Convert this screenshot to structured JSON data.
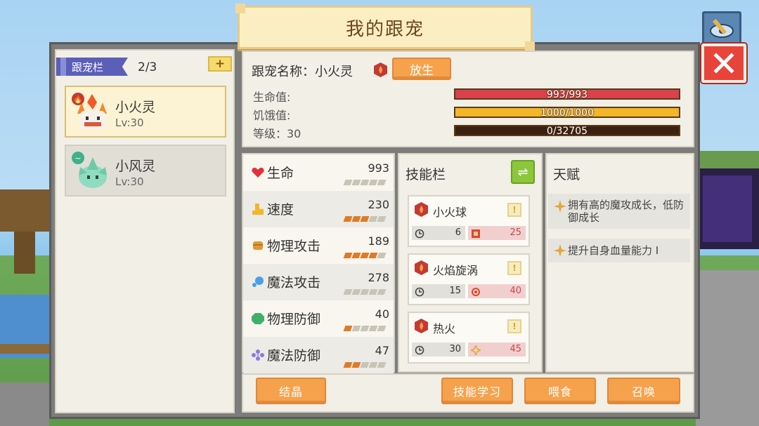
{
  "title": "我的跟宠",
  "pet_list": {
    "tag": "跟宠栏",
    "count": "2/3",
    "add_label": "+",
    "pets": [
      {
        "name": "小火灵",
        "level": "Lv:30",
        "element": "fire"
      },
      {
        "name": "小风灵",
        "level": "Lv:30",
        "element": "wind"
      }
    ]
  },
  "info": {
    "name_line": "跟宠名称：小火灵",
    "release_label": "放生",
    "hp_label": "生命值:",
    "hp_text": "993/993",
    "hp_fraction": 1.0,
    "hunger_label": "饥饿值:",
    "hunger_text": "1000/1000",
    "hunger_fraction": 1.0,
    "level_label": "等级：30",
    "exp_text": "0/32705",
    "exp_fraction": 0.0,
    "colors": {
      "hp": "#d9424a",
      "hunger": "#f2b628",
      "exp": "#3b2210"
    }
  },
  "attributes": [
    {
      "name": "生命",
      "value": "993",
      "pips": 0,
      "icon": "heart-icon"
    },
    {
      "name": "速度",
      "value": "230",
      "pips": 3,
      "icon": "boot-icon"
    },
    {
      "name": "物理攻击",
      "value": "189",
      "pips": 4,
      "icon": "fist-icon"
    },
    {
      "name": "魔法攻击",
      "value": "278",
      "pips": 0,
      "icon": "magic-icon"
    },
    {
      "name": "物理防御",
      "value": "40",
      "pips": 1,
      "icon": "shield-icon"
    },
    {
      "name": "魔法防御",
      "value": "47",
      "pips": 2,
      "icon": "flower-icon"
    }
  ],
  "skills": {
    "title": "技能栏",
    "swap_label": "⇌",
    "list": [
      {
        "name": "小火球",
        "cooldown": "6",
        "power": "25"
      },
      {
        "name": "火焰旋涡",
        "cooldown": "15",
        "power": "40"
      },
      {
        "name": "热火",
        "cooldown": "30",
        "power": "45"
      }
    ]
  },
  "talent": {
    "title": "天赋",
    "items": [
      {
        "text": "拥有高的魔攻成长，低防御成长"
      },
      {
        "text": "提升自身血量能力 I"
      }
    ]
  },
  "buttons": {
    "crystal": "结晶",
    "learn": "技能学习",
    "feed": "喂食",
    "summon": "召唤"
  }
}
